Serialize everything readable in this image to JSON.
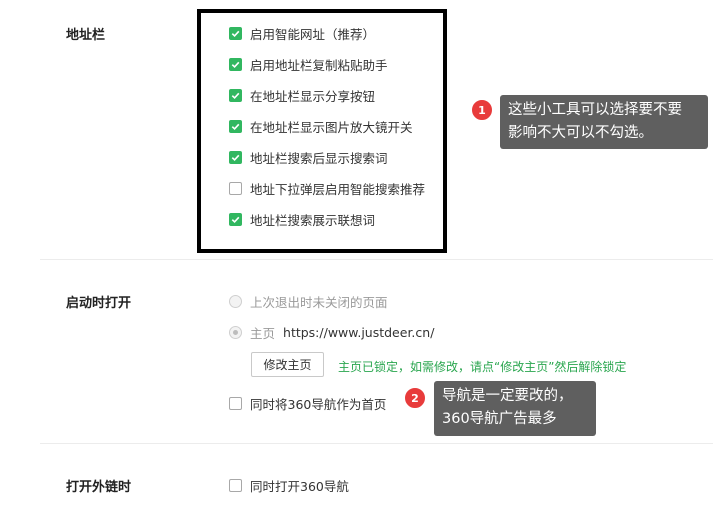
{
  "address_bar": {
    "label": "地址栏",
    "options": [
      {
        "label": "启用智能网址（推荐）",
        "checked": true
      },
      {
        "label": "启用地址栏复制粘贴助手",
        "checked": true
      },
      {
        "label": "在地址栏显示分享按钮",
        "checked": true
      },
      {
        "label": "在地址栏显示图片放大镜开关",
        "checked": true
      },
      {
        "label": "地址栏搜索后显示搜索词",
        "checked": true
      },
      {
        "label": "地址下拉弹层启用智能搜索推荐",
        "checked": false
      },
      {
        "label": "地址栏搜索展示联想词",
        "checked": true
      }
    ]
  },
  "callout1": {
    "number": "1",
    "line1": "这些小工具可以选择要不要",
    "line2": "影响不大可以不勾选。"
  },
  "startup": {
    "label": "启动时打开",
    "option_restore": "上次退出时未关闭的页面",
    "option_home": "主页",
    "home_url": "https://www.justdeer.cn/",
    "modify_button": "修改主页",
    "locked_notice": "主页已锁定，如需修改，请点“修改主页”然后解除锁定",
    "nav_option": "同时将360导航作为首页"
  },
  "callout2": {
    "number": "2",
    "line1": "导航是一定要改的，",
    "line2": "360导航广告最多"
  },
  "external_link": {
    "label": "打开外链时",
    "option": "同时打开360导航"
  },
  "colors": {
    "checkbox_checked": "#31b760",
    "badge": "#e83b3b",
    "callout_bg": "#5f5f5f",
    "locked_text": "#2aa64f"
  }
}
